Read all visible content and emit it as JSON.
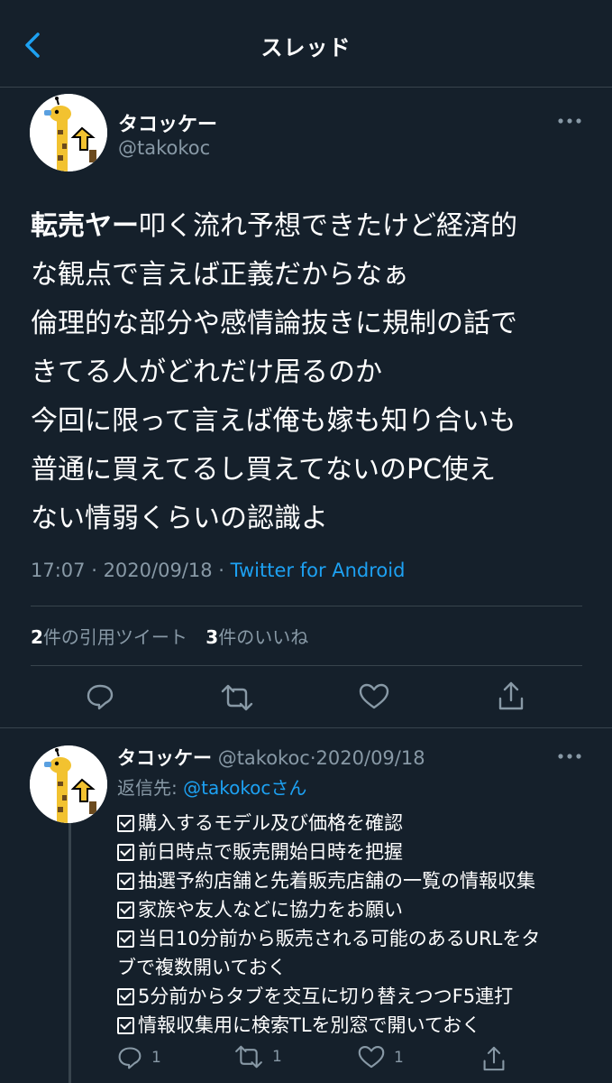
{
  "header": {
    "title": "スレッド"
  },
  "main_tweet": {
    "author": {
      "name": "タコッケー",
      "handle": "@takokoc"
    },
    "body_first_bold": "転売ヤー",
    "body_first_rest": "叩く流れ予想できたけど経済的",
    "body_lines": [
      "な観点で言えば正義だからなぁ",
      "倫理的な部分や感情論抜きに規制の話で",
      "きてる人がどれだけ居るのか",
      "今回に限って言えば俺も嫁も知り合いも",
      "普通に買えてるし買えてないのPC使え",
      "ない情弱くらいの認識よ"
    ],
    "time": "17:07",
    "date": "2020/09/18",
    "source": "Twitter for Android",
    "quote_count": "2",
    "quote_label": "件の引用ツイート",
    "like_count": "3",
    "like_label": "件のいいね"
  },
  "reply_tweet": {
    "author": {
      "name": "タコッケー",
      "handle": "@takokoc",
      "date": "2020/09/18"
    },
    "reply_to_label": "返信先: ",
    "reply_to_handle": "@takokoc",
    "reply_to_suffix": "さん",
    "checklist": [
      "購入するモデル及び価格を確認",
      "前日時点で販売開始日時を把握",
      "抽選予約店舗と先着販売店舗の一覧の情報収集",
      "家族や友人などに協力をお願い",
      "当日10分前から販売される可能のあるURLをタ",
      "5分前からタブを交互に切り替えつつF5連打",
      "情報収集用に検索TLを別窓で開いておく"
    ],
    "checklist_continuation": "ブで複数開いておく",
    "reply_count": "1",
    "retweet_count": "1",
    "like_count": "1"
  },
  "colors": {
    "background": "#15202b",
    "divider": "#38444d",
    "secondary_text": "#8899a6",
    "accent": "#1da1f2"
  },
  "icons": [
    "back-arrow-icon",
    "more-icon",
    "reply-icon",
    "retweet-icon",
    "like-icon",
    "share-icon"
  ]
}
